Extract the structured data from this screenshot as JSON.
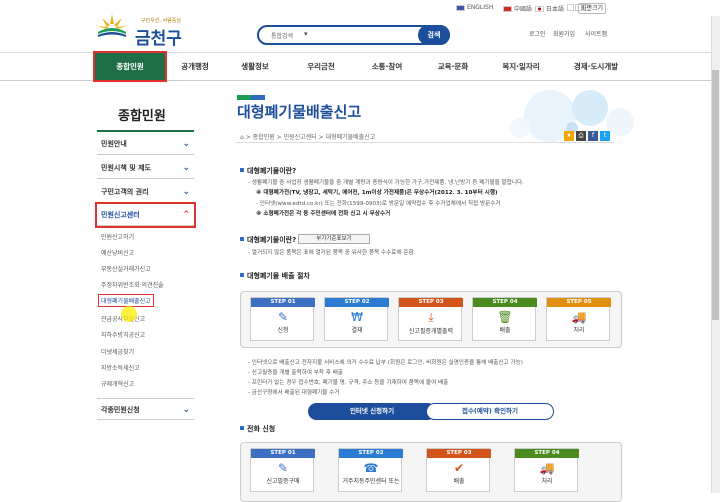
{
  "topbar": {
    "english": "ENGLISH",
    "china": "中國語",
    "japan": "日本語",
    "zoom": "화면크기"
  },
  "header": {
    "logo": "금천구",
    "slogan": "구민우선, 사람중심",
    "search_select": "통합검색",
    "search_btn": "검색",
    "login": "로그인",
    "join": "회원가입",
    "sitemap": "사이트맵"
  },
  "gnb": [
    "종합민원",
    "공개행정",
    "생활정보",
    "우리금천",
    "소통·참여",
    "교육·문화",
    "복지·일자리",
    "경제·도시개발"
  ],
  "lnb": {
    "title": "종합민원",
    "items": [
      "민원안내",
      "민원시책 및 제도",
      "구민고객의 권리",
      "민원신고센터",
      "각종민원신청"
    ],
    "subs": [
      "민원신고하기",
      "예산낭비신고",
      "부동산실거래가신고",
      "주정차위반조회·의견진술",
      "대형폐기물배출신고",
      "관급공사부실신고",
      "지하수방치공신고",
      "더넷세금찾기",
      "지방소득세신고",
      "규제개혁신고"
    ]
  },
  "main": {
    "title": "대형폐기물배출신고",
    "breadcrumb": [
      "종합민원",
      "민원신고센터",
      "대형폐기물배출신고"
    ],
    "sec1": "대형폐기물이란?",
    "sec1_lines": [
      "- 생활폐기물 중 사업장 생활폐기물을 중 개별 계량과 종량식이 가능한 가구,가전제품, 냉.난방기 등 폐기물을 말합니다.",
      "※ 대형폐가전(TV, 냉장고, 세탁기, 에어컨, 1m이상 가전제품)은 무상수거(2012. 3. 10부터 시행)",
      "- 인터넷(www.edtd.co.kr) 또는 전화(1599-0903)로 방문일 예약접수 후 수거업체에서 직접 방문수거",
      "※ 소형폐가전은 각 동 주민센터에 전화 신고 시 무상수거"
    ],
    "sec2": "대형폐기물이란?",
    "sec2_btn": "부가기준표보기",
    "sec2_line": "- 열거되지 않은 품목은 표에 열거된 품목 중 유사한 품목 수수료에 준함.",
    "sec3": "대형폐기물 배출 절차",
    "steps": [
      {
        "hd": "STEP 01",
        "label": "신청",
        "color": "#3d6fc3",
        "icon": "✎"
      },
      {
        "hd": "STEP 02",
        "label": "결재",
        "color": "#2a7bd1",
        "icon": "₩"
      },
      {
        "hd": "STEP 03",
        "label": "신고필증개별출력",
        "color": "#d2541b",
        "icon": "⤓"
      },
      {
        "hd": "STEP 04",
        "label": "배출",
        "color": "#4a8a1f",
        "icon": "🗑"
      },
      {
        "hd": "STEP 05",
        "label": "처리",
        "color": "#e0900e",
        "icon": "🚚"
      }
    ],
    "sec3_lines": [
      "- 인터넷으로 배출신고 전자지불 서비스에 의거 수수료 납부 (회원은 로그인, 비회원은 실명인증을 통해 배출신고 가능)",
      "- 신고필증을 개별 출력하여 부착 후 배출",
      "- 프린터가 없는 경우 접수번호, 폐기물 명, 규격, 주소 등을 기재하여 품목에 붙여 배출",
      "- 금산구청에서 배출된 대형폐기물 수거"
    ],
    "btn1": "인터넷 신청하기",
    "btn2": "접수(예약) 확인하기",
    "sec4": "전화 신청",
    "steps2": [
      {
        "hd": "STEP 01",
        "label": "신고필증구매",
        "color": "#3d6fc3",
        "icon": "✎"
      },
      {
        "hd": "STEP 02",
        "label": "거주지동주민센터 또는",
        "color": "#2a7bd1",
        "icon": "☎"
      },
      {
        "hd": "STEP 03",
        "label": "배출",
        "color": "#d2541b",
        "icon": "✔"
      },
      {
        "hd": "STEP 04",
        "label": "처리",
        "color": "#4a8a1f",
        "icon": "🚚"
      }
    ]
  }
}
